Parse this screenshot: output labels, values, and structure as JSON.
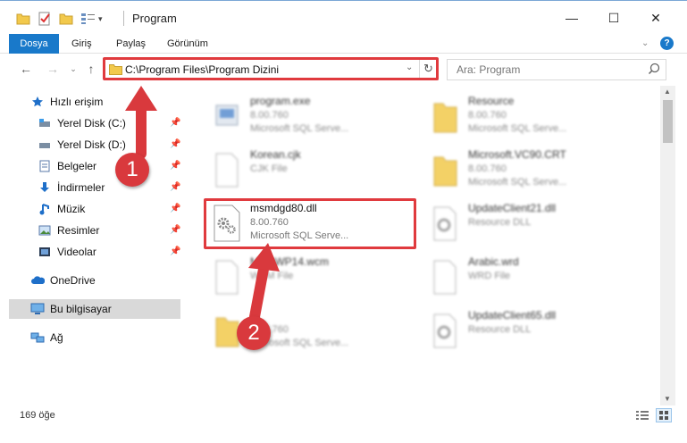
{
  "window": {
    "title": "Program",
    "controls": {
      "minimize": "—",
      "maximize": "☐",
      "close": "✕"
    }
  },
  "ribbon": {
    "tabs": [
      "Dosya",
      "Giriş",
      "Paylaş",
      "Görünüm"
    ],
    "help": "?"
  },
  "nav": {
    "address": "C:\\Program Files\\Program Dizini",
    "search_placeholder": "Ara: Program"
  },
  "sidebar": {
    "items": [
      {
        "label": "Hızlı erişim",
        "icon": "star-icon"
      },
      {
        "label": "Yerel Disk (C:)",
        "icon": "drive-icon"
      },
      {
        "label": "Yerel Disk (D:)",
        "icon": "drive-icon"
      },
      {
        "label": "Belgeler",
        "icon": "documents-icon"
      },
      {
        "label": "İndirmeler",
        "icon": "download-icon"
      },
      {
        "label": "Müzik",
        "icon": "music-icon"
      },
      {
        "label": "Resimler",
        "icon": "pictures-icon"
      },
      {
        "label": "Videolar",
        "icon": "video-icon"
      },
      {
        "label": "OneDrive",
        "icon": "cloud-icon"
      },
      {
        "label": "Bu bilgisayar",
        "icon": "computer-icon"
      },
      {
        "label": "Ağ",
        "icon": "network-icon"
      }
    ]
  },
  "files": [
    {
      "name": "program.exe",
      "line2": "8.00.760",
      "line3": "Microsoft SQL Serve..."
    },
    {
      "name": "Resource",
      "line2": "8.00.760",
      "line3": "Microsoft SQL Serve..."
    },
    {
      "name": "Korean.cjk",
      "line2": "CJK File",
      "line3": ""
    },
    {
      "name": "Microsoft.VC90.CRT",
      "line2": "8.00.760",
      "line3": "Microsoft SQL Serve..."
    },
    {
      "name": "msmdgd80.dll",
      "line2": "8.00.760",
      "line3": "Microsoft SQL Serve..."
    },
    {
      "name": "UpdateClient21.dll",
      "line2": "Resource DLL",
      "line3": ""
    },
    {
      "name": "MSOWP14.wcm",
      "line2": "WCM File",
      "line3": ""
    },
    {
      "name": "Arabic.wrd",
      "line2": "WRD File",
      "line3": ""
    },
    {
      "name": "",
      "line2": "8.00.760",
      "line3": "Microsoft SQL Serve..."
    },
    {
      "name": "UpdateClient65.dll",
      "line2": "Resource DLL",
      "line3": ""
    }
  ],
  "status": {
    "count": "169 öğe"
  },
  "annotations": {
    "badge1": "1",
    "badge2": "2"
  },
  "colors": {
    "accent": "#1979ca",
    "annotation": "#e03a3e"
  }
}
